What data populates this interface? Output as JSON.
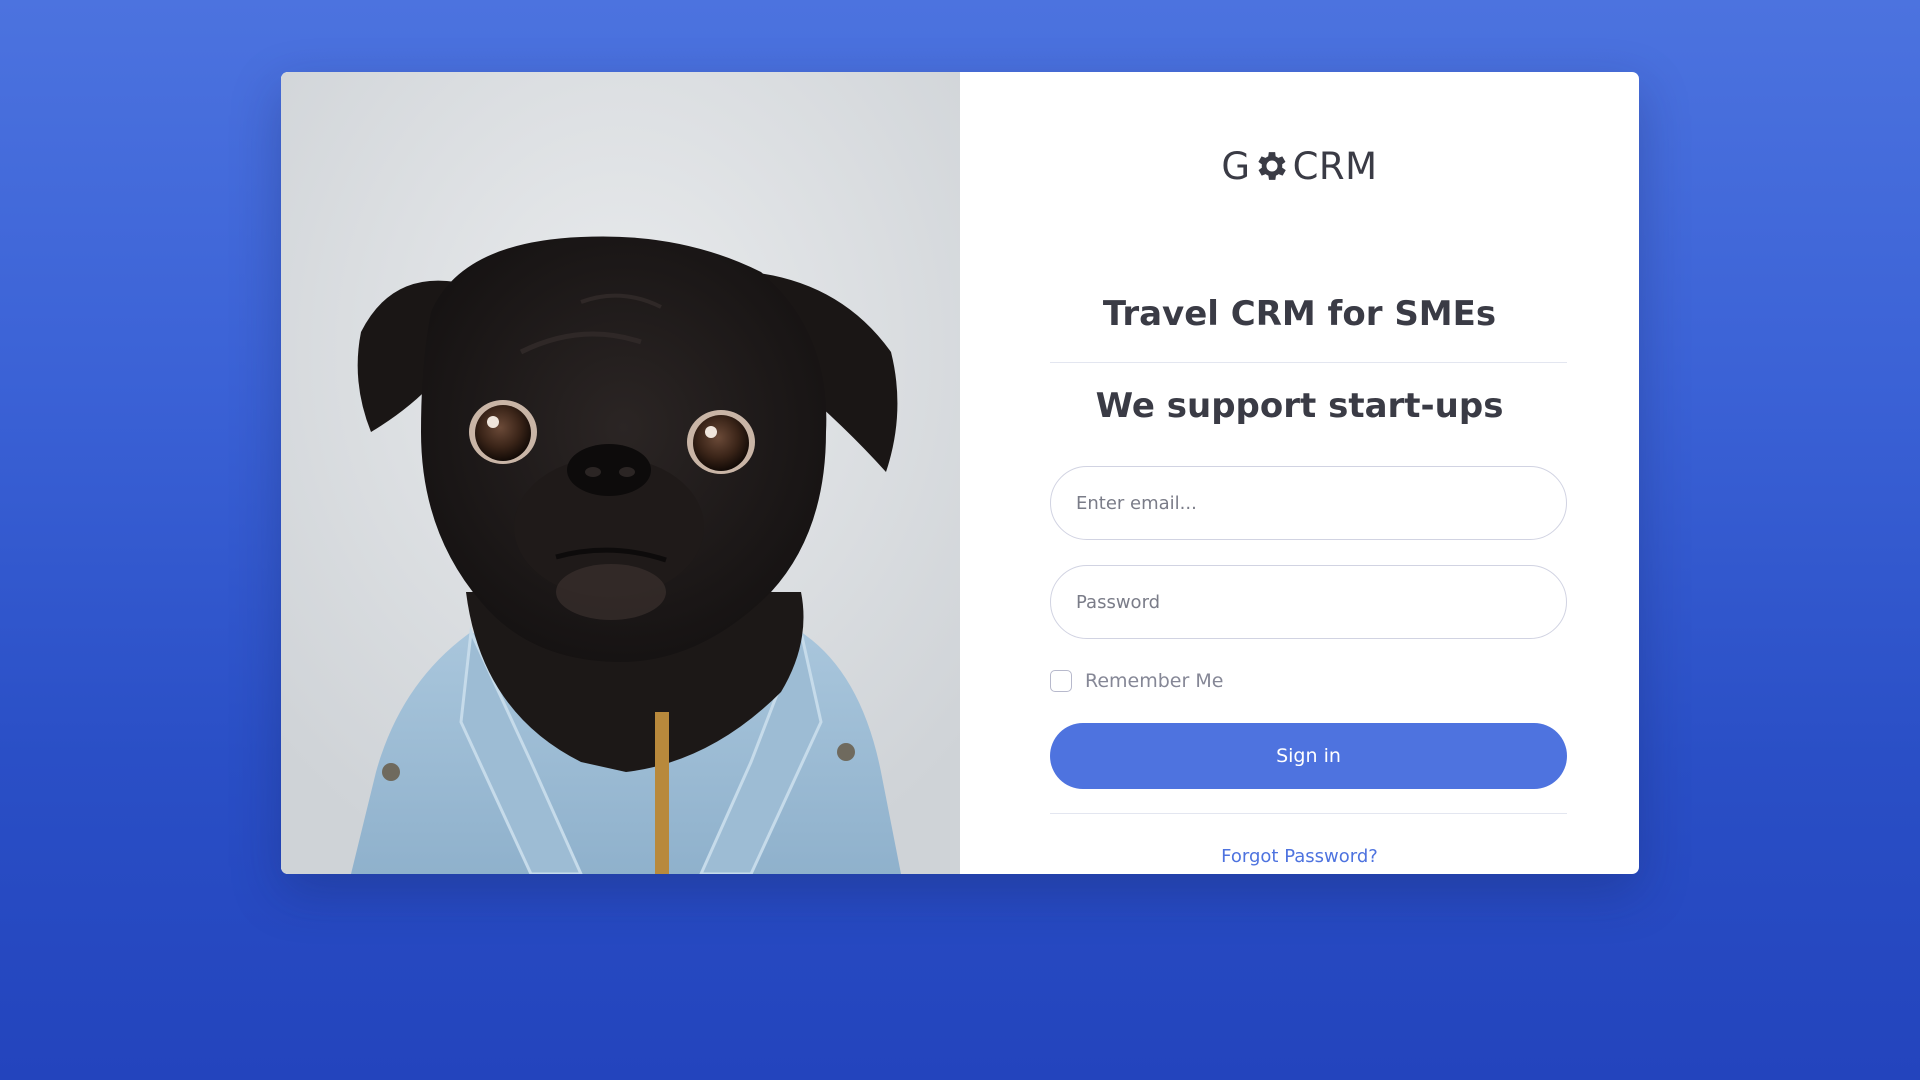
{
  "brand": {
    "name_prefix": "G",
    "name_suffix": "CRM",
    "logo_icon": "gear-icon"
  },
  "headings": {
    "tagline": "Travel CRM for SMEs",
    "slogan": "We support start-ups"
  },
  "form": {
    "email_placeholder": "Enter email...",
    "email_value": "",
    "password_placeholder": "Password",
    "password_value": "",
    "remember_label": "Remember Me",
    "remember_checked": false,
    "signin_label": "Sign in",
    "forgot_label": "Forgot Password?"
  },
  "image": {
    "subject": "black pug wearing a denim jacket"
  },
  "colors": {
    "primary": "#4e73df",
    "background_top": "#4c73df",
    "background_bottom": "#2344bd",
    "text_dark": "#3a3b45",
    "text_muted": "#858796"
  }
}
